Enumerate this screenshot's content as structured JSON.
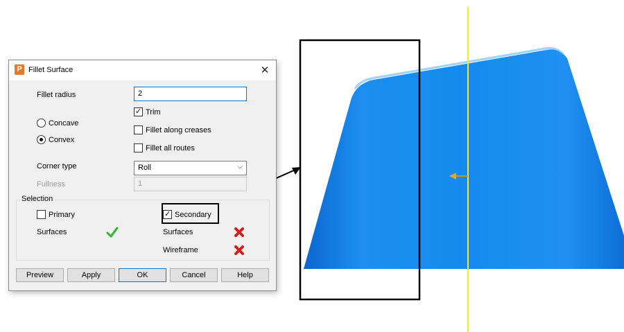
{
  "dialog": {
    "title": "Fillet Surface",
    "icon": "P",
    "fillet_radius_label": "Fillet radius",
    "fillet_radius_value": "2",
    "trim_label": "Trim",
    "trim_checked": true,
    "concave_label": "Concave",
    "convex_label": "Convex",
    "selected_profile": "Convex",
    "fillet_along_creases_label": "Fillet along creases",
    "fillet_all_routes_label": "Fillet all routes",
    "corner_type_label": "Corner type",
    "corner_type_value": "Roll",
    "fullness_label": "Fullness",
    "fullness_value": "1",
    "selection": {
      "group_label": "Selection",
      "primary_label": "Primary",
      "primary_checked": false,
      "secondary_label": "Secondary",
      "secondary_checked": true,
      "primary_surfaces_label": "Surfaces",
      "secondary_surfaces_label": "Surfaces",
      "secondary_wireframe_label": "Wireframe"
    },
    "buttons": {
      "preview": "Preview",
      "apply": "Apply",
      "ok": "OK",
      "cancel": "Cancel",
      "help": "Help"
    }
  },
  "colors": {
    "surface": "#1a86e8",
    "surface_shadow": "#0d63c4",
    "guide_line": "#f2ee1e",
    "tick_green": "#2db52d",
    "cross_red": "#d0201a",
    "app_icon": "#e8792b"
  }
}
